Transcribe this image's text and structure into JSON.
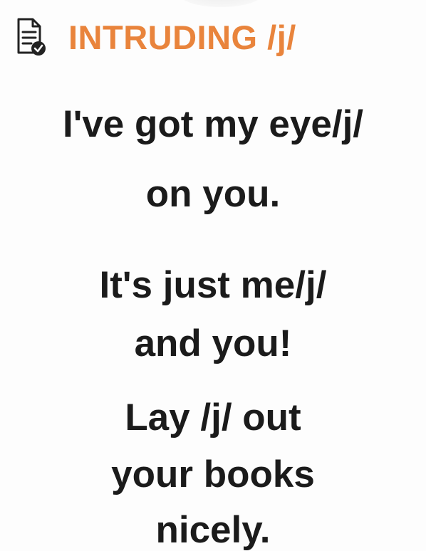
{
  "header": {
    "icon": "document-check-icon",
    "title": "INTRUDING /j/",
    "title_color": "#e9843c"
  },
  "examples": [
    {
      "lines": [
        "I've got my eye/j/",
        "on you."
      ]
    },
    {
      "lines": [
        "It's just me/j/",
        "and you!"
      ]
    },
    {
      "lines": [
        "Lay /j/ out",
        "your books",
        "nicely."
      ]
    }
  ]
}
